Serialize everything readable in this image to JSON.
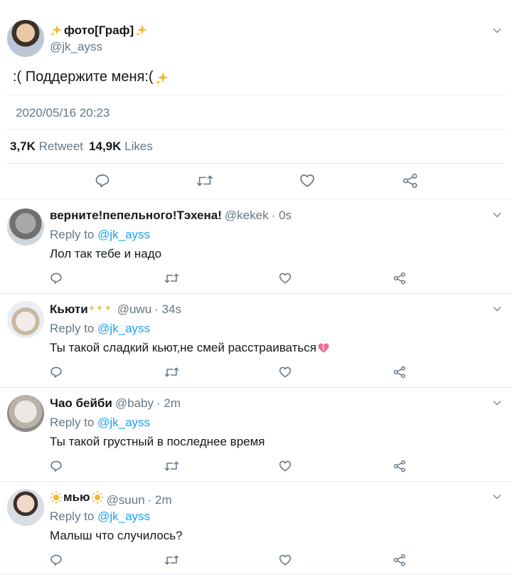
{
  "main_tweet": {
    "author_name": "фото[Граф]",
    "handle": "@jk_ayss",
    "text": ":( Поддержите меня:(",
    "date": "2020/05/16 20:23",
    "retweets_count": "3,7K",
    "retweets_label": "Retweet",
    "likes_count": "14,9K",
    "likes_label": "Likes"
  },
  "replies": [
    {
      "name": "верните!пепельного!Тэхена!",
      "handle": "@kekek",
      "time": "· 0s",
      "reply_prefix": "Reply to",
      "reply_to": "@jk_ayss",
      "text": "Лол так тебе и надо"
    },
    {
      "name": "Кьюти",
      "handle": "@uwu",
      "time": "· 34s",
      "reply_prefix": "Reply to",
      "reply_to": "@jk_ayss",
      "text": "Ты такой сладкий кьют,не смей расстраиваться"
    },
    {
      "name": "Чао бейби",
      "handle": "@baby",
      "time": "· 2m",
      "reply_prefix": "Reply to",
      "reply_to": "@jk_ayss",
      "text": "Ты такой грустный в последнее время"
    },
    {
      "name": "мью",
      "handle": "@suun",
      "time": "· 2m",
      "reply_prefix": "Reply to",
      "reply_to": "@jk_ayss",
      "text": "Малыш что случилось?"
    }
  ],
  "colors": {
    "link": "#1da1f2",
    "muted": "#657786",
    "text": "#14171a",
    "sparkle": "#f5b72a",
    "broken_heart": "#f06b9a"
  },
  "icons": [
    "chevron-down-icon",
    "reply-icon",
    "retweet-icon",
    "like-icon",
    "share-icon",
    "sparkles-icon",
    "sun-icon",
    "broken-heart-icon"
  ]
}
